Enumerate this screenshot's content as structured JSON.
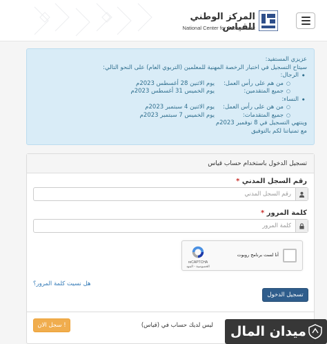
{
  "header": {
    "title_ar": "المركز الوطني للقياس",
    "title_en": "National Center for Assessment"
  },
  "notice": {
    "greeting": "عزيزي المستفيد:",
    "intro": "سيتاح التسجيل في اختبار الرخصة المهنية للمعلمين (التربوي العام) على النحو التالي:",
    "men": {
      "title": "الرجال:",
      "rows": [
        {
          "label": "من هم على رأس العمل:",
          "value": "يوم الاثنين 28 أغسطس 2023م"
        },
        {
          "label": "جميع المتقدمين:",
          "value": "يوم الخميس 31 أغسطس 2023م"
        }
      ]
    },
    "women": {
      "title": "النساء:",
      "rows": [
        {
          "label": "من هن على رأس العمل:",
          "value": "يوم الاثنين 4 سبتمبر 2023م"
        },
        {
          "label": "جميع المتقدمات:",
          "value": "يوم الخميس 7 سبتمبر 2023م"
        }
      ]
    },
    "end": "وينتهي التسجيل في 8 نوفمبر 2023م",
    "wish": "مع تمنياتنا لكم بالتوفيق"
  },
  "login": {
    "heading": "تسجيل الدخول باستخدام حساب قياس",
    "id_label": "رقم السجل المدني",
    "id_placeholder": "رقم السجل المدني",
    "password_label": "كلمة المرور",
    "password_placeholder": "كلمة المرور",
    "required_mark": "*",
    "captcha_text": "أنا لست برنامج روبوت",
    "captcha_brand": "reCAPTCHA",
    "captcha_terms": "الخصوصية - البنود",
    "forgot": "هل نسيت كلمة المرور؟",
    "submit": "تسجيل الدخول",
    "no_account": "ليس لديك حساب في (قياس)",
    "register": "سجل الان !"
  },
  "watermark": {
    "text": "ميدان المال"
  },
  "colors": {
    "notice_bg": "#d9ecf7",
    "notice_text": "#31708f",
    "primary": "#2f5d8c",
    "warning": "#f0ad4e",
    "link": "#337ab7"
  }
}
